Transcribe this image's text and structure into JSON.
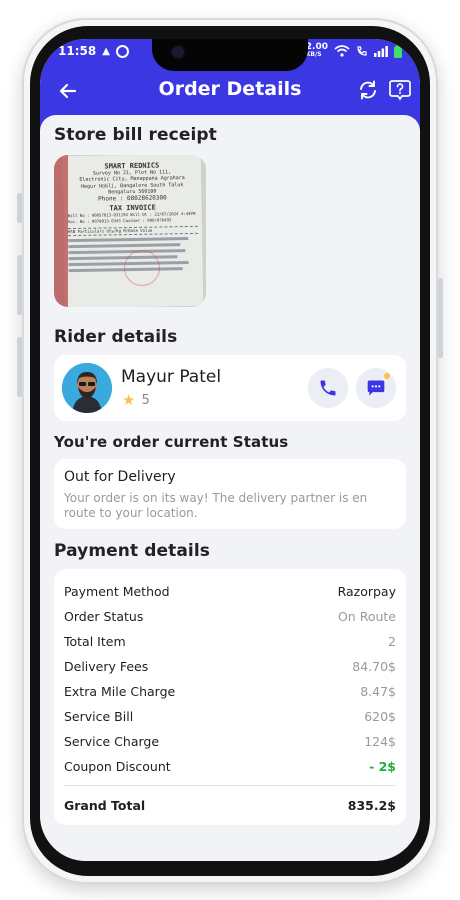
{
  "status_bar": {
    "time": "11:58",
    "net_speed": "2.00",
    "net_unit": "KB/S"
  },
  "header": {
    "title": "Order Details"
  },
  "icons": {
    "back": "arrow-left-icon",
    "refresh": "refresh-icon",
    "help": "help-chat-icon"
  },
  "sections": {
    "bill": "Store bill receipt",
    "rider": "Rider details",
    "status": "You're order current Status",
    "payment": "Payment details"
  },
  "receipt": {
    "store": "SMART REDNICS",
    "addr1": "Survey No 21, Plot No 111,",
    "addr2": "Electronic City, Manappana Agrahara",
    "addr3": "Hegur Hobli, Bangalore South Taluk",
    "addr4": "Bengaluru 560100",
    "phone": "Phone : 08028620300",
    "invoice": "TAX INVOICE",
    "bill_line": "Bill No : 00057013-031194  Bill Dt : 22/07/2024 4:44PM",
    "cashier": "Voc. No : 0070013-0343     Cashier : 008/078495",
    "cols": "HSN  Particulars      Qty/Kg   M/Rate    Value"
  },
  "rider": {
    "name": "Mayur Patel",
    "rating": "5"
  },
  "order_status": {
    "title": "Out for Delivery",
    "description": "Your order is on its way! The delivery partner is en route to your location."
  },
  "payment": {
    "rows": [
      {
        "label": "Payment Method",
        "value": "Razorpay"
      },
      {
        "label": "Order Status",
        "value": "On Route"
      },
      {
        "label": "Total Item",
        "value": "2"
      },
      {
        "label": "Delivery Fees",
        "value": "84.70$"
      },
      {
        "label": "Extra Mile Charge",
        "value": "8.47$"
      },
      {
        "label": "Service Bill",
        "value": "620$"
      },
      {
        "label": "Service Charge",
        "value": "124$"
      },
      {
        "label": "Coupon Discount",
        "value": "- 2$"
      }
    ],
    "grand_total_label": "Grand Total",
    "grand_total_value": "835.2$"
  },
  "colors": {
    "primary": "#3a37e3",
    "discount": "#19b23a",
    "star": "#f4c443"
  }
}
